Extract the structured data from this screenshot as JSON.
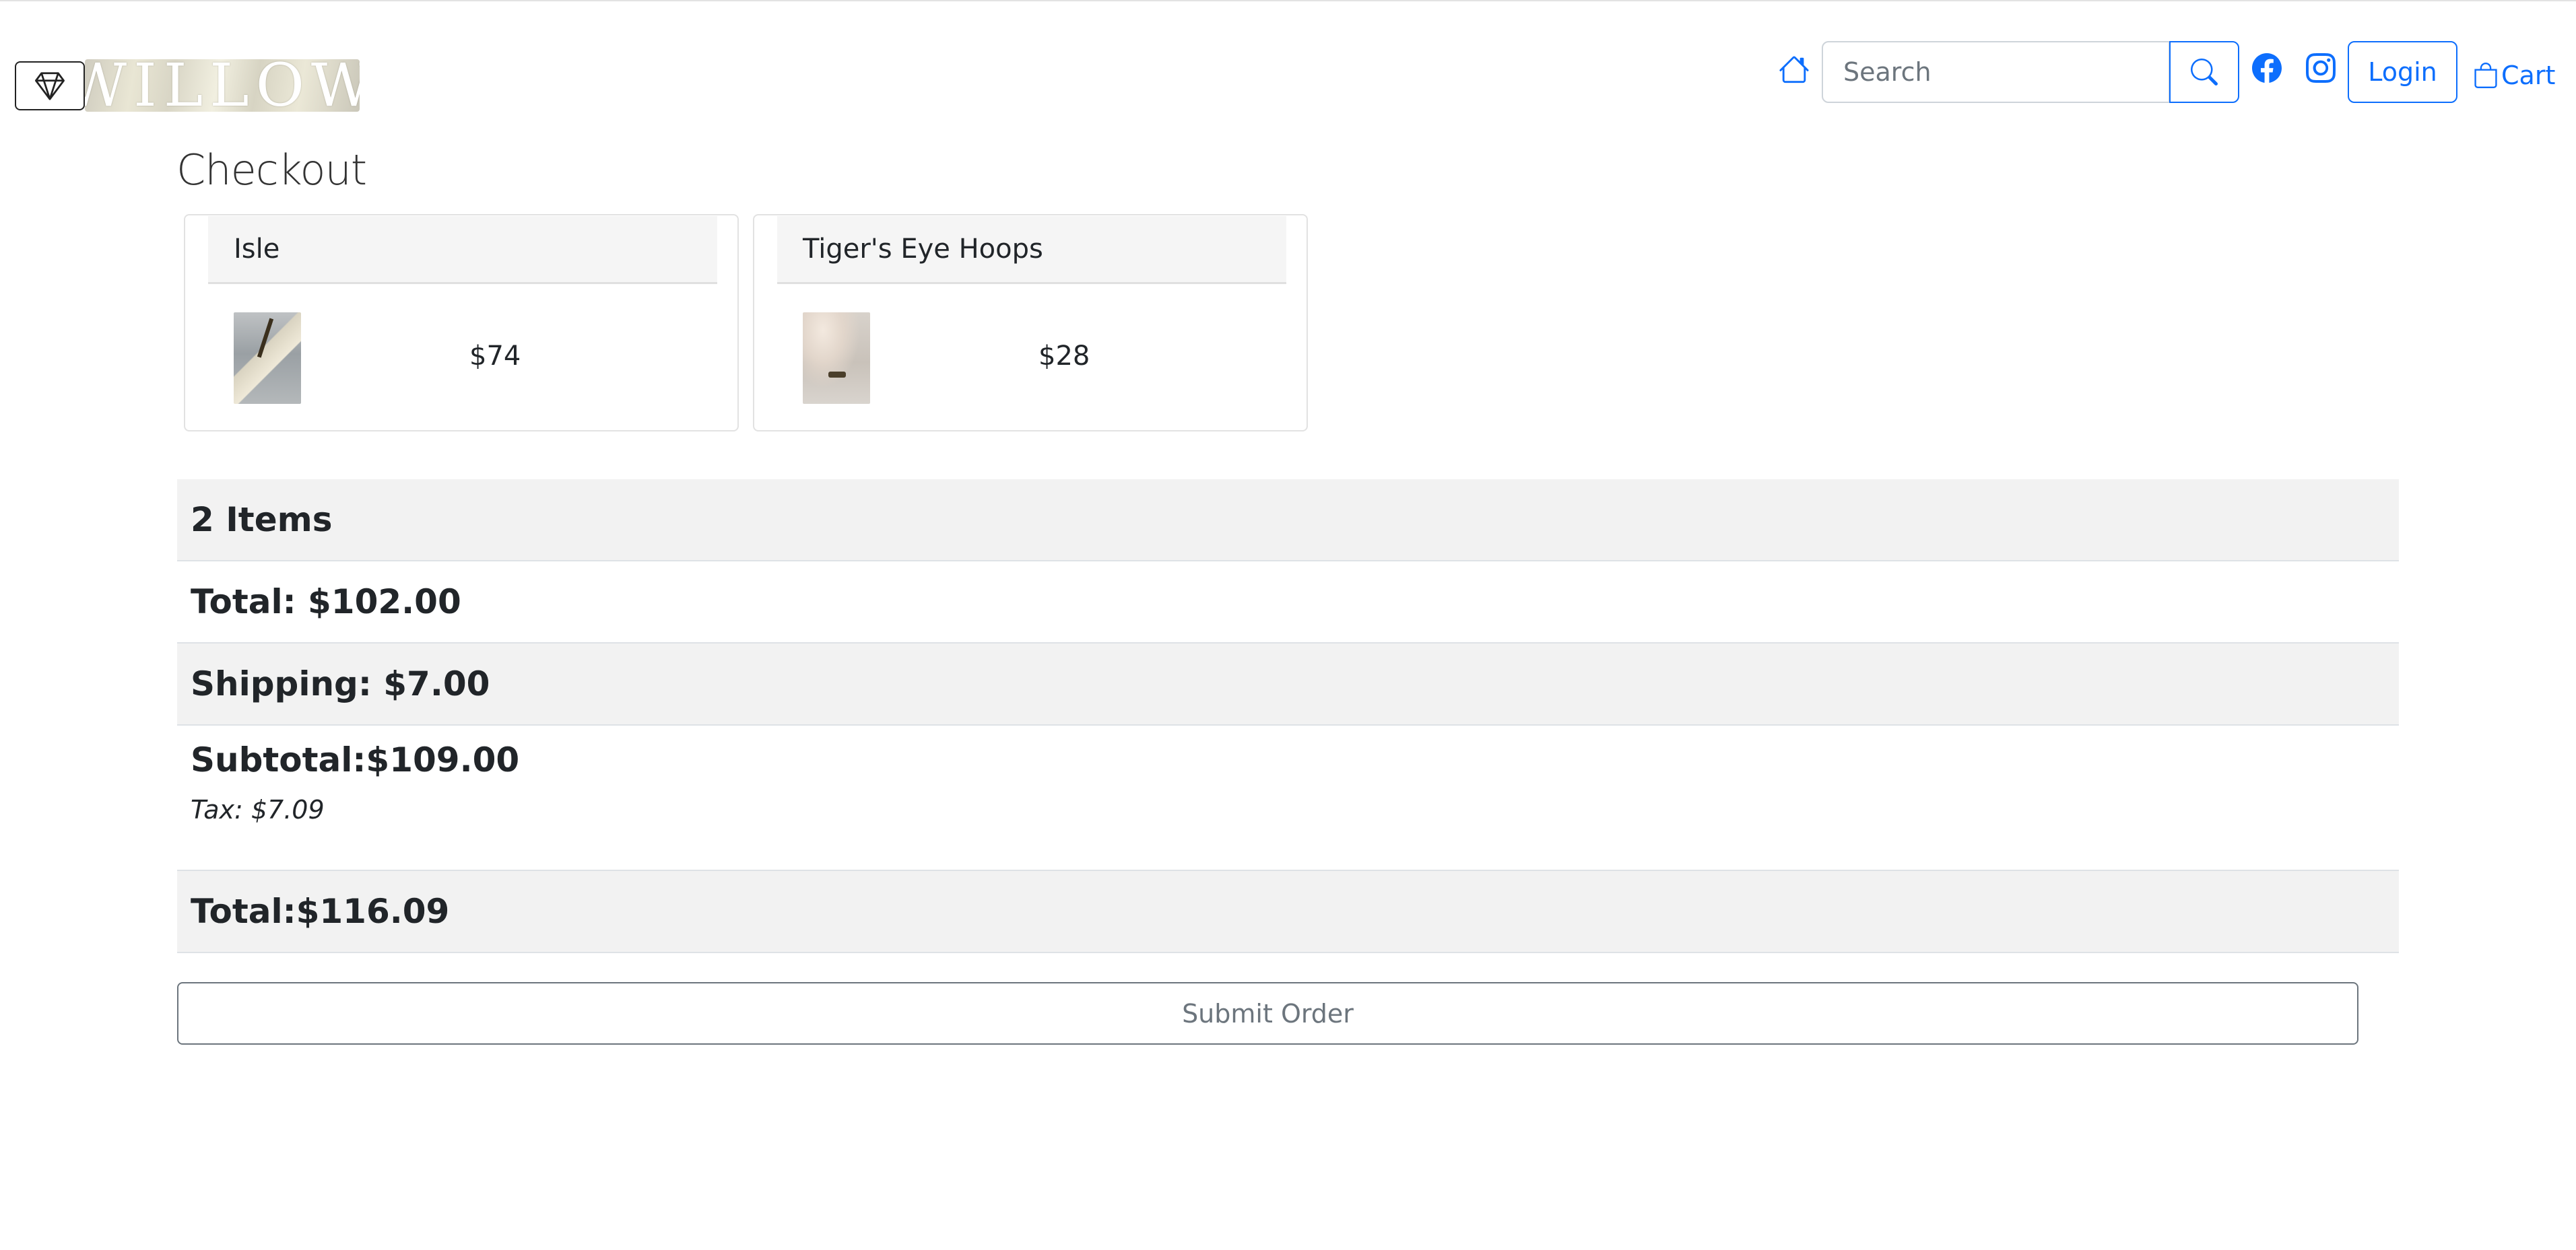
{
  "header": {
    "logo_text": "WILLOW",
    "search": {
      "placeholder": "Search",
      "value": ""
    },
    "login_label": "Login",
    "cart_label": "Cart",
    "icons": {
      "brand": "gem-icon",
      "home": "house-icon",
      "search": "search-icon",
      "facebook": "facebook-icon",
      "instagram": "instagram-icon",
      "cart": "bag-icon"
    },
    "accent_color": "#0d6efd"
  },
  "page": {
    "title": "Checkout"
  },
  "items": [
    {
      "name": "Isle",
      "price": "$74"
    },
    {
      "name": "Tiger's Eye Hoops",
      "price": "$28"
    }
  ],
  "summary": {
    "items_count": "2 Items",
    "total": "Total: $102.00",
    "shipping": "Shipping: $7.00",
    "subtotal": "Subtotal:$109.00",
    "tax": "Tax: $7.09",
    "grand_total": "Total:$116.09"
  },
  "actions": {
    "submit_label": "Submit Order"
  }
}
